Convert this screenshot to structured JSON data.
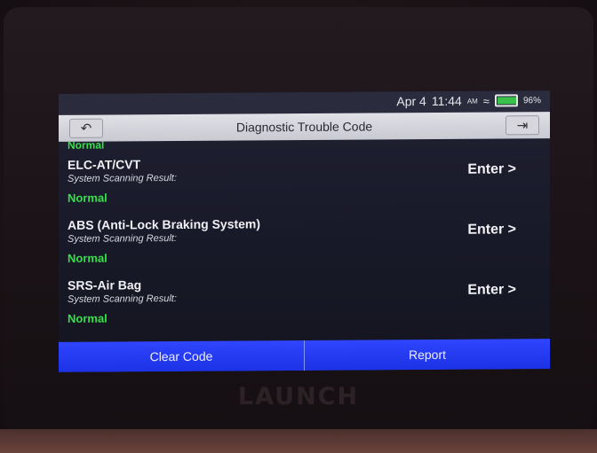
{
  "status": {
    "date": "Apr 4",
    "time": "11:44",
    "am_pm": "AM",
    "battery": "96%",
    "battery_level": 0.96
  },
  "header": {
    "title": "Diagnostic Trouble Code"
  },
  "list": {
    "top_status": "Normal",
    "items": [
      {
        "name": "ELC-AT/CVT",
        "subtitle": "System Scanning Result:",
        "status": "Normal",
        "action": "Enter >"
      },
      {
        "name": "ABS (Anti-Lock Braking System)",
        "subtitle": "System Scanning Result:",
        "status": "Normal",
        "action": "Enter >"
      },
      {
        "name": "SRS-Air Bag",
        "subtitle": "System Scanning Result:",
        "status": "Normal",
        "action": "Enter >"
      }
    ]
  },
  "footer": {
    "clear_code": "Clear Code",
    "report": "Report"
  },
  "device": {
    "brand": "LAUNCH"
  },
  "colors": {
    "accent_blue": "#1f36f0",
    "status_green": "#36e04a"
  }
}
